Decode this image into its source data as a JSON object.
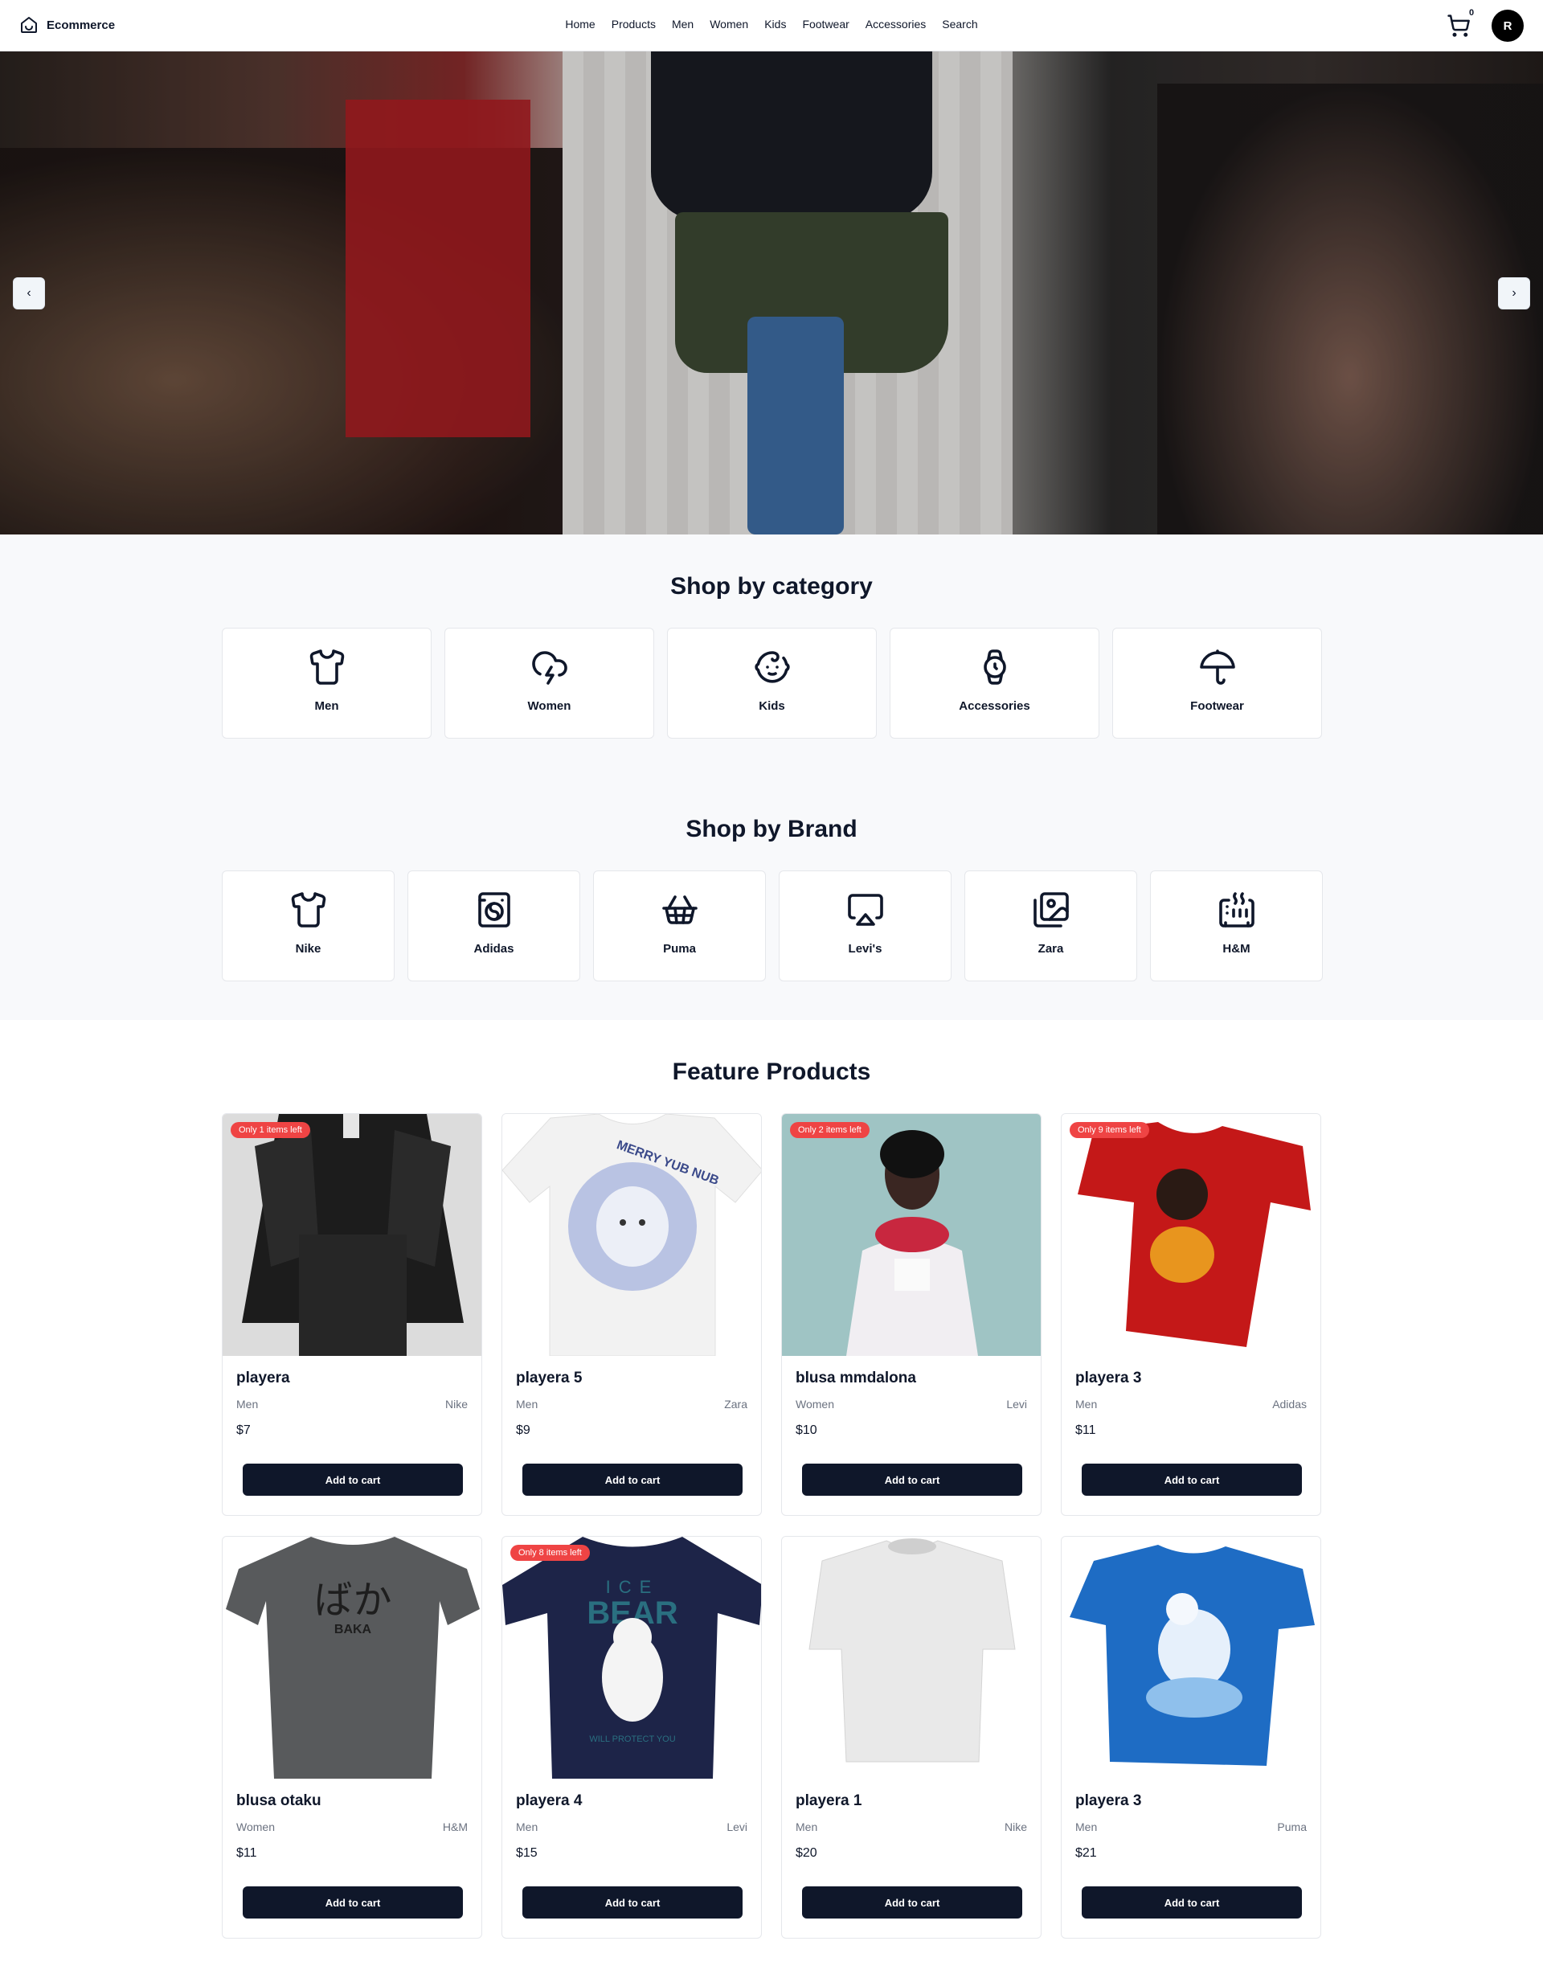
{
  "header": {
    "brand": "Ecommerce",
    "nav": [
      "Home",
      "Products",
      "Men",
      "Women",
      "Kids",
      "Footwear",
      "Accessories",
      "Search"
    ],
    "cart_count": "0",
    "avatar_initial": "R"
  },
  "hero": {
    "prev_label": "‹",
    "next_label": "›"
  },
  "categories": {
    "title": "Shop by category",
    "items": [
      {
        "label": "Men",
        "icon": "shirt-icon"
      },
      {
        "label": "Women",
        "icon": "cloud-lightning-icon"
      },
      {
        "label": "Kids",
        "icon": "baby-icon"
      },
      {
        "label": "Accessories",
        "icon": "watch-icon"
      },
      {
        "label": "Footwear",
        "icon": "umbrella-icon"
      }
    ]
  },
  "brands": {
    "title": "Shop by Brand",
    "items": [
      {
        "label": "Nike",
        "icon": "shirt-icon"
      },
      {
        "label": "Adidas",
        "icon": "washing-machine-icon"
      },
      {
        "label": "Puma",
        "icon": "shopping-basket-icon"
      },
      {
        "label": "Levi's",
        "icon": "airplay-icon"
      },
      {
        "label": "Zara",
        "icon": "images-icon"
      },
      {
        "label": "H&M",
        "icon": "heater-icon"
      }
    ]
  },
  "products": {
    "title": "Feature Products",
    "button_label": "Add to cart",
    "items": [
      {
        "name": "playera",
        "category": "Men",
        "brand": "Nike",
        "price": "$7",
        "badge": "Only 1 items left"
      },
      {
        "name": "playera 5",
        "category": "Men",
        "brand": "Zara",
        "price": "$9",
        "badge": ""
      },
      {
        "name": "blusa mmdalona",
        "category": "Women",
        "brand": "Levi",
        "price": "$10",
        "badge": "Only 2 items left"
      },
      {
        "name": "playera 3",
        "category": "Men",
        "brand": "Adidas",
        "price": "$11",
        "badge": "Only 9 items left"
      },
      {
        "name": "blusa otaku",
        "category": "Women",
        "brand": "H&M",
        "price": "$11",
        "badge": ""
      },
      {
        "name": "playera 4",
        "category": "Men",
        "brand": "Levi",
        "price": "$15",
        "badge": "Only 8 items left"
      },
      {
        "name": "playera 1",
        "category": "Men",
        "brand": "Nike",
        "price": "$20",
        "badge": ""
      },
      {
        "name": "playera 3",
        "category": "Men",
        "brand": "Puma",
        "price": "$21",
        "badge": ""
      }
    ],
    "image_text": {
      "merry": "MERRY YUB NUB",
      "ice": "ICE",
      "bear": "BEAR",
      "will": "WILL PROTECT YOU",
      "baka_jp": "ばか",
      "baka": "BAKA"
    }
  },
  "colors": {
    "primary": "#0f172a",
    "badge": "#ef4444",
    "section_bg": "#f8f9fb"
  }
}
